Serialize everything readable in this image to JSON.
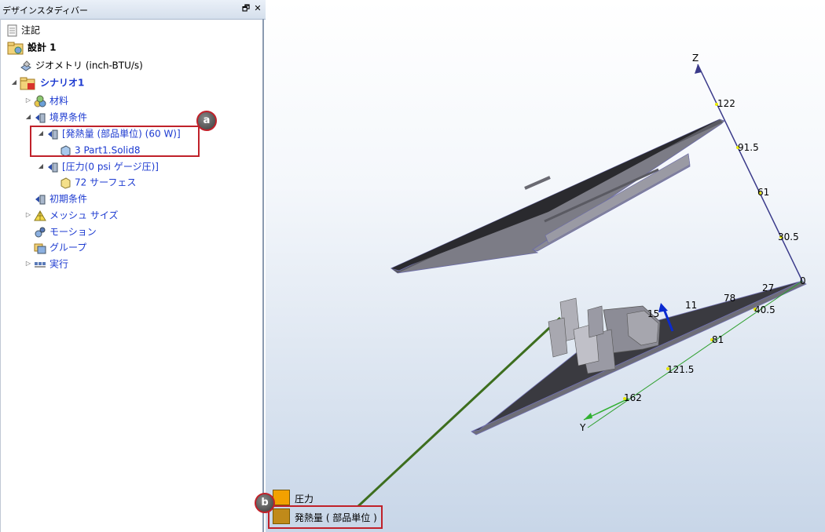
{
  "panel": {
    "title": "デザインスタディバー",
    "pin_glyph": "🗗",
    "close_glyph": "✕"
  },
  "tree": {
    "notes": "注記",
    "design": "設計 1",
    "geometry": "ジオメトリ (inch-BTU/s)",
    "scenario": "シナリオ1",
    "materials": "材料",
    "boundary_conditions": "境界条件",
    "heat_generation": "[発熱量 (部品単位) (60 W)]",
    "heat_part": "3 Part1.Solid8",
    "pressure": "[圧力(0 psi ゲージ圧)]",
    "pressure_surface": "72 サーフェス",
    "initial_conditions": "初期条件",
    "mesh_size": "メッシュ サイズ",
    "motion": "モーション",
    "group": "グループ",
    "run": "実行"
  },
  "callouts": {
    "a": "a",
    "b": "b"
  },
  "axes": {
    "z_label": "Z",
    "y_label": "Y",
    "z_ticks": [
      "122",
      "91.5",
      "61",
      "30.5",
      "0"
    ],
    "x_ticks": [
      "40.5",
      "81",
      "121.5",
      "162"
    ],
    "partial_ticks": [
      "27",
      "78",
      "11",
      "15"
    ]
  },
  "legend": {
    "items": [
      {
        "label": "圧力",
        "color": "#f2a100"
      },
      {
        "label": "発熱量 ( 部品単位 )",
        "color": "#c08a1a"
      }
    ]
  },
  "colors": {
    "accent_red": "#c0212a",
    "tree_blue": "#1c3ad0"
  }
}
